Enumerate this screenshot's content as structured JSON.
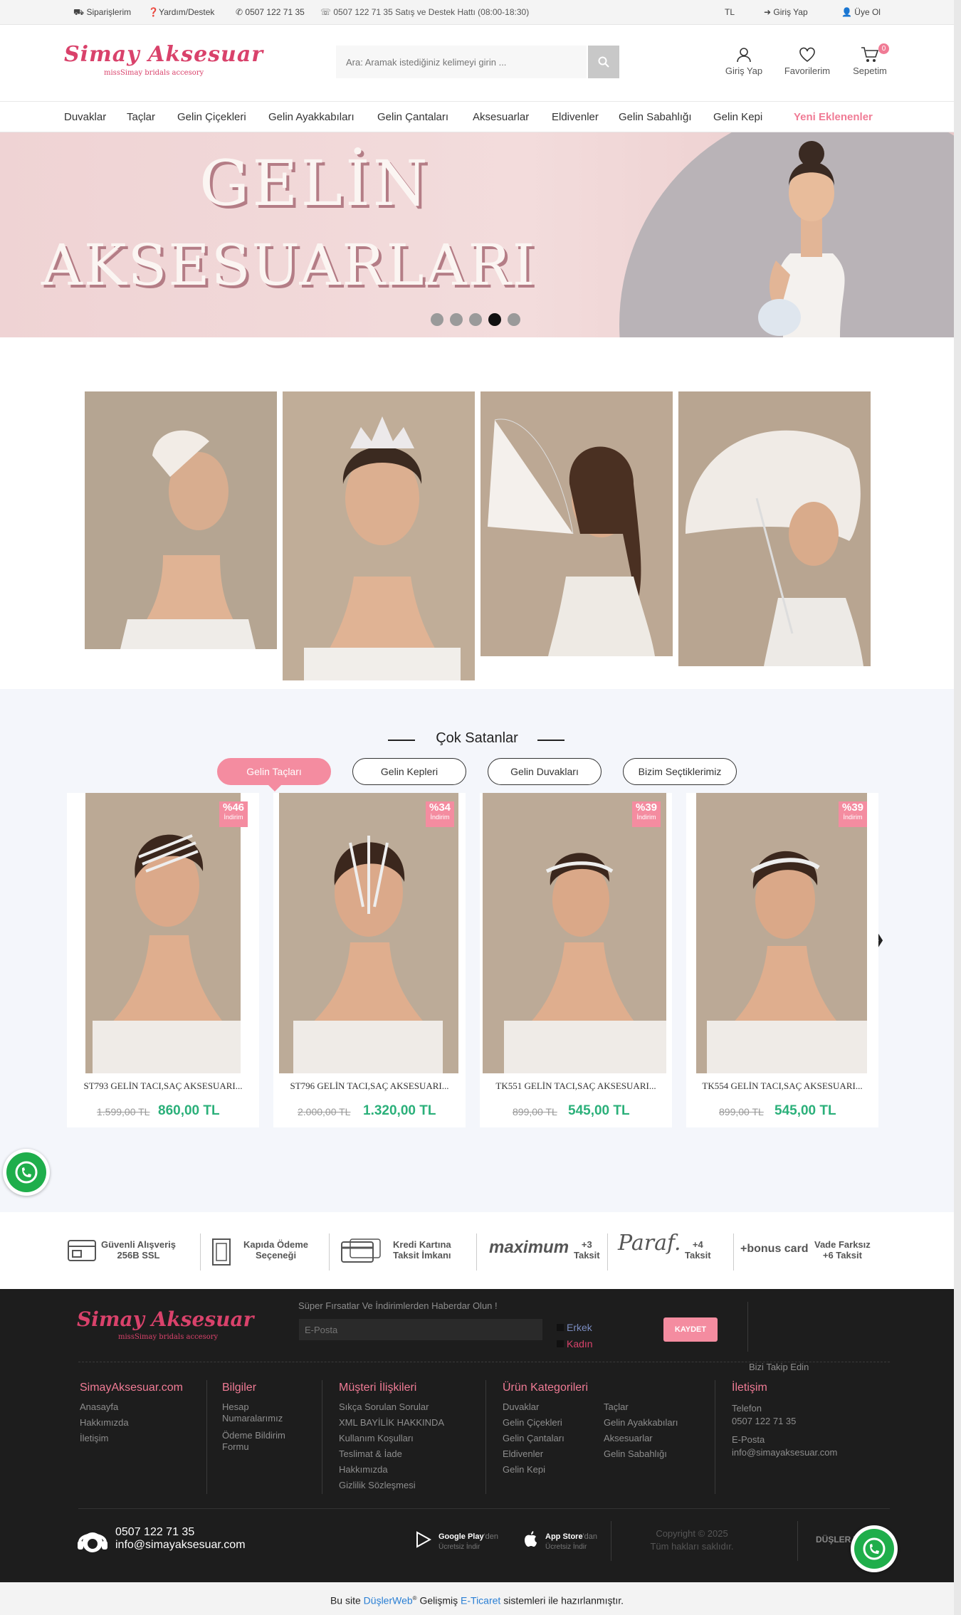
{
  "topbar": {
    "orders": "Siparişlerim",
    "help": "Yardım/Destek",
    "whatsapp": "0507 122 71 35",
    "hotline": "0507 122 71 35 Satış ve Destek Hattı (08:00-18:30)",
    "currency": "TL",
    "login": "Giriş Yap",
    "register": "Üye Ol"
  },
  "header": {
    "logo": "Simay Aksesuar",
    "logo_sub": "missSimay bridals accesory",
    "search_placeholder": "Ara: Aramak istediğiniz kelimeyi girin ...",
    "login": "Giriş Yap",
    "favorites": "Favorilerim",
    "cart": "Sepetim",
    "cart_count": "0"
  },
  "nav": [
    "Duvaklar",
    "Taçlar",
    "Gelin Çiçekleri",
    "Gelin Ayakkabıları",
    "Gelin Çantaları",
    "Aksesuarlar",
    "Eldivenler",
    "Gelin Sabahlığı",
    "Gelin Kepi",
    "Yeni Eklenenler"
  ],
  "hero": {
    "line1": "GELİN",
    "line2": "AKSESUARLARI",
    "slides": 5,
    "active_slide": 4
  },
  "best_sellers": {
    "title": "Çok Satanlar",
    "tabs": [
      "Gelin Taçları",
      "Gelin Kepleri",
      "Gelin Duvakları",
      "Bizim Seçtiklerimiz"
    ],
    "active_tab": 0,
    "discount_label": "İndirim",
    "products": [
      {
        "name": "ST793 GELİN TACI,SAÇ AKSESUARI...",
        "old_price": "1.599,00 TL",
        "price": "860,00 TL",
        "discount": "%46"
      },
      {
        "name": "ST796 GELİN TACI,SAÇ AKSESUARI...",
        "old_price": "2.000,00 TL",
        "price": "1.320,00 TL",
        "discount": "%34"
      },
      {
        "name": "TK551 GELİN TACI,SAÇ AKSESUARI...",
        "old_price": "899,00 TL",
        "price": "545,00 TL",
        "discount": "%39"
      },
      {
        "name": "TK554 GELİN TACI,SAÇ AKSESUARI...",
        "old_price": "899,00 TL",
        "price": "545,00 TL",
        "discount": "%39"
      }
    ]
  },
  "trust": {
    "secure_1": "Güvenli Alışveriş",
    "secure_2": "256B SSL",
    "cod_1": "Kapıda Ödeme",
    "cod_2": "Seçeneği",
    "card_1": "Kredi Kartına",
    "card_2": "Taksit İmkanı",
    "maximum": "maximum",
    "maximum_inst_1": "+3",
    "maximum_inst_2": "Taksit",
    "paraf": "Paraf.",
    "paraf_inst_1": "+4",
    "paraf_inst_2": "Taksit",
    "bonus": "+bonus card",
    "bonus_inst_1": "Vade Farksız",
    "bonus_inst_2": "+6 Taksit"
  },
  "footer": {
    "newsletter_title": "Süper Fırsatlar Ve İndirimlerden Haberdar Olun !",
    "email_placeholder": "E-Posta",
    "gender_male": "Erkek",
    "gender_female": "Kadın",
    "save": "KAYDET",
    "follow": "Bizi Takip Edin",
    "col1_title": "SimayAksesuar.com",
    "col1": [
      "Anasayfa",
      "Hakkımızda",
      "İletişim"
    ],
    "col2_title": "Bilgiler",
    "col2": [
      "Hesap Numaralarımız",
      "Ödeme Bildirim Formu"
    ],
    "col3_title": "Müşteri İlişkileri",
    "col3": [
      "Sıkça Sorulan Sorular",
      "XML BAYİLİK HAKKINDA",
      "Kullanım Koşulları",
      "Teslimat & İade",
      "Hakkımızda",
      "Gizlilik Sözleşmesi"
    ],
    "col4_title": "Ürün Kategorileri",
    "col4a": [
      "Duvaklar",
      "Gelin Çiçekleri",
      "Gelin Çantaları",
      "Eldivenler",
      "Gelin Kepi"
    ],
    "col4b": [
      "Taçlar",
      "Gelin Ayakkabıları",
      "Aksesuarlar",
      "Gelin Sabahlığı"
    ],
    "col5_title": "İletişim",
    "phone_label": "Telefon",
    "phone": "0507 122 71 35",
    "email_label": "E-Posta",
    "email": "info@simayaksesuar.com",
    "bottom_phone": "0507 122 71 35",
    "bottom_email": "info@simayaksesuar.com",
    "gplay": "Google Play",
    "gplay_sfx": "'den",
    "gplay_sub": "Ücretsiz İndir",
    "appstore": "App Store",
    "appstore_sfx": "'dan",
    "appstore_sub": "Ücretsiz İndir",
    "copyright_1": "Copyright © 2025",
    "copyright_2": "Tüm hakları saklıdır.",
    "dusler": "DÜŞLER WEB"
  },
  "bottom_bar": {
    "prefix": "Bu site",
    "brand": "DüşlerWeb",
    "mid": "Gelişmiş",
    "link": "E-Ticaret",
    "suffix": "sistemleri ile hazırlanmıştır."
  }
}
